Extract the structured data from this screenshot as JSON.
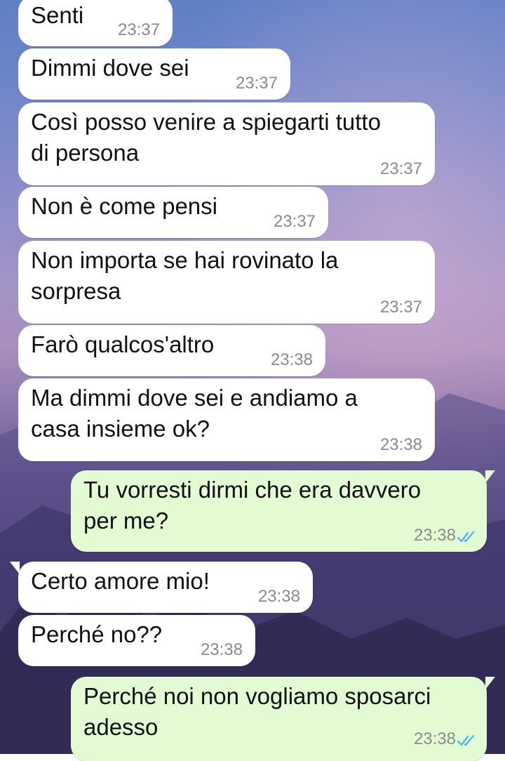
{
  "colors": {
    "incoming_bubble": "#ffffff",
    "outgoing_bubble": "#e3fbd2",
    "timestamp": "#8a8a8a",
    "read_ticks": "#4fb6ec"
  },
  "icons": {
    "read_receipt": "double-check-icon"
  },
  "messages": [
    {
      "direction": "incoming",
      "text": [
        "Senti"
      ],
      "time": "23:37"
    },
    {
      "direction": "incoming",
      "text": [
        "Dimmi dove sei"
      ],
      "time": "23:37"
    },
    {
      "direction": "incoming",
      "text": [
        "Così posso venire a spiegarti tutto",
        "di persona"
      ],
      "time": "23:37"
    },
    {
      "direction": "incoming",
      "text": [
        "Non è come pensi"
      ],
      "time": "23:37"
    },
    {
      "direction": "incoming",
      "text": [
        "Non importa se hai rovinato la",
        "sorpresa"
      ],
      "time": "23:37"
    },
    {
      "direction": "incoming",
      "text": [
        "Farò qualcos'altro"
      ],
      "time": "23:38"
    },
    {
      "direction": "incoming",
      "text": [
        "Ma dimmi dove sei e andiamo a",
        "casa insieme ok?"
      ],
      "time": "23:38"
    },
    {
      "direction": "outgoing",
      "text": [
        "Tu vorresti dirmi che era davvero",
        "per me?"
      ],
      "time": "23:38",
      "status": "read"
    },
    {
      "direction": "incoming",
      "text": [
        "Certo amore mio!"
      ],
      "time": "23:38"
    },
    {
      "direction": "incoming",
      "text": [
        "Perché no??"
      ],
      "time": "23:38"
    },
    {
      "direction": "outgoing",
      "text": [
        "Perché noi non vogliamo sposarci",
        "adesso"
      ],
      "time": "23:38",
      "status": "read"
    }
  ]
}
